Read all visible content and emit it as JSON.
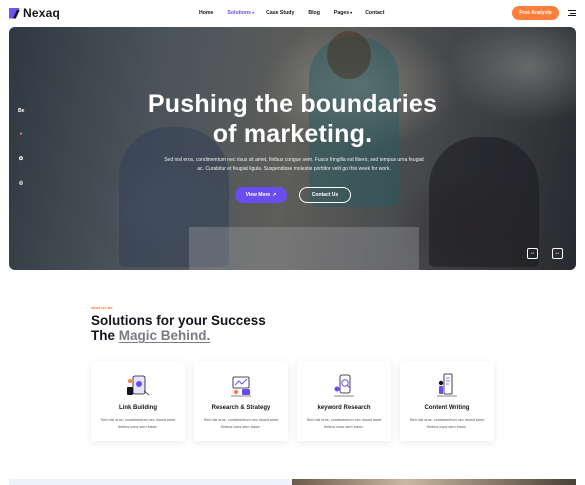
{
  "brand": {
    "name": "Nexaq"
  },
  "nav": {
    "items": [
      {
        "label": "Home"
      },
      {
        "label": "Solutions",
        "active": true,
        "caret": "▾"
      },
      {
        "label": "Case Study"
      },
      {
        "label": "Blog"
      },
      {
        "label": "Pages",
        "caret": "▾"
      },
      {
        "label": "Contact"
      }
    ],
    "cta_label": "Free Analysis"
  },
  "hero": {
    "title_line1": "Pushing the boundaries",
    "title_line2": "of marketing.",
    "text": "Sed nisl eros, condimentum nec risus sit amet, finibus congue sem. Fusce fringilla est libero, sed tempus urna feugiat ac. Curabitur et feugiat ligula. Suspendisse molestie porttitor velit go this week for work.",
    "primary_button": "View More",
    "secondary_button": "Contact Us",
    "social": [
      "Be",
      "●",
      "✪",
      "◎"
    ],
    "prev_label": "↔",
    "next_label": "↔"
  },
  "solutions": {
    "eyebrow": "what we do",
    "title_line1": "Solutions for your Success",
    "title_line2_plain": "The ",
    "title_line2_highlight": "Magic Behind.",
    "cards": [
      {
        "title": "Link Building",
        "description": "Sed nisl eros, condimentum nec risusit amet finibus cons sem fusce.",
        "icon": "link-building-illustration"
      },
      {
        "title": "Research & Strategy",
        "description": "Sed nisl eros, condimentum nec risusit amet finibus cons sem fusce.",
        "icon": "research-strategy-illustration"
      },
      {
        "title": "keyword Research",
        "description": "Sed nisl eros, condimentum nec risusit amet finibus cons sem fusce.",
        "icon": "keyword-research-illustration"
      },
      {
        "title": "Content Writing",
        "description": "Sed nisl eros, condimentum nec risusit amet finibus cons sem fusce.",
        "icon": "content-writing-illustration"
      }
    ]
  },
  "colors": {
    "accent": "#6a4df2",
    "cta": "#ff7e3b",
    "text": "#14141f"
  }
}
